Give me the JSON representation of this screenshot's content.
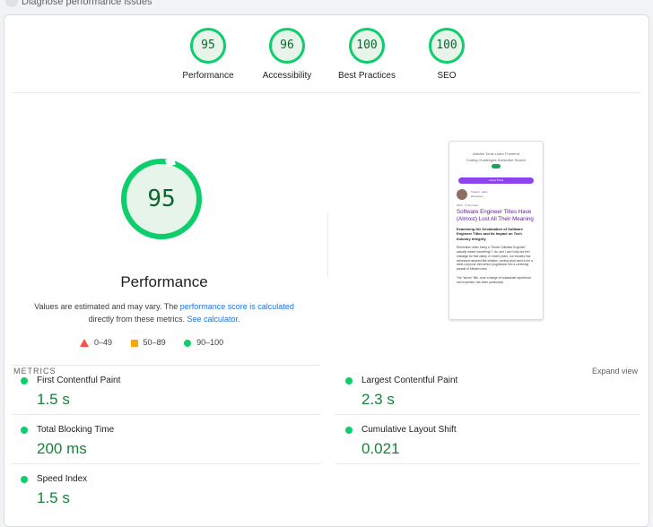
{
  "header": {
    "crumb": "Diagnose performance issues"
  },
  "gauges": [
    {
      "score": "95",
      "label": "Performance"
    },
    {
      "score": "96",
      "label": "Accessibility"
    },
    {
      "score": "100",
      "label": "Best Practices"
    },
    {
      "score": "100",
      "label": "SEO"
    }
  ],
  "performance": {
    "score": "95",
    "title": "Performance",
    "desc_prefix": "Values are estimated and may vary. The ",
    "desc_link1": "performance score is calculated",
    "desc_mid": " directly from these metrics. ",
    "desc_link2": "See calculator."
  },
  "legend": {
    "red": "0–49",
    "orange": "50–89",
    "green": "90–100"
  },
  "thumbnail": {
    "nav1": "Articles   Tools   Learn Frontend",
    "nav2": "Coding Challenges   Subscribe   Search",
    "banner": "Latest Posts",
    "author_name": "Trevor I. Lasn",
    "author_role": "Developer",
    "date": "2024 · 5 min read",
    "title": "Software Engineer Titles Have (Almost) Lost All Their Meaning",
    "subtitle": "Examining the Devaluation of Software Engineer Titles and Its Impact on Tech Industry Integrity",
    "body1": "Remember when being a \"Senior Software Engineer\" actually meant something? I do, and I can't help but feel nostalgic for that clarity. In recent years, our industry has witnessed rampant title inflation, turning what used to be a clear-cut junior-mid-senior progression into a confusing parade of inflated roles.",
    "body2": "The \"senior\" title, once a badge of substantial experience and expertise, has been particularly"
  },
  "metrics": {
    "heading": "METRICS",
    "expand": "Expand view",
    "items": [
      {
        "label": "First Contentful Paint",
        "value": "1.5 s"
      },
      {
        "label": "Largest Contentful Paint",
        "value": "2.3 s"
      },
      {
        "label": "Total Blocking Time",
        "value": "200 ms"
      },
      {
        "label": "Cumulative Layout Shift",
        "value": "0.021"
      },
      {
        "label": "Speed Index",
        "value": "1.5 s"
      }
    ]
  },
  "colors": {
    "pass": "#0cce6b",
    "average": "#ffa400",
    "fail": "#ff4e42",
    "link": "#1a73e8"
  }
}
